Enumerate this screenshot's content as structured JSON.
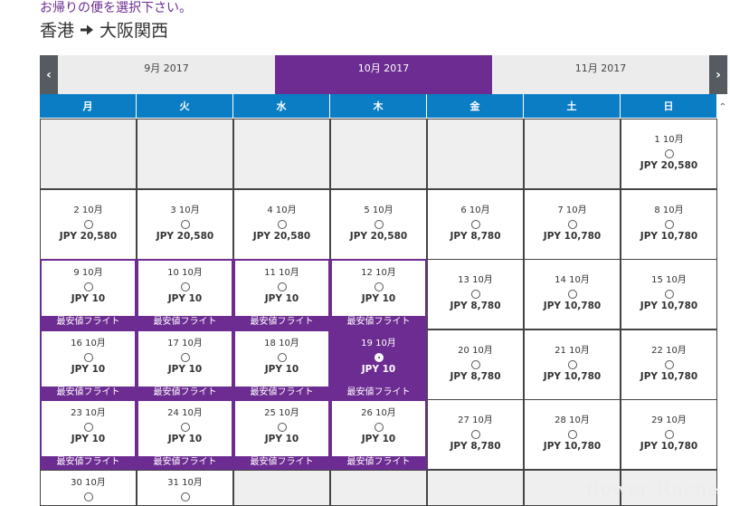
{
  "page": {
    "instruction": "お帰りの便を選択下さい。",
    "route_from": "香港",
    "route_to": "大阪関西"
  },
  "months": {
    "prev_icon": "chevron-left-icon",
    "next_icon": "chevron-right-icon",
    "tabs": [
      {
        "label": "9月 2017",
        "active": false
      },
      {
        "label": "10月 2017",
        "active": true
      },
      {
        "label": "11月 2017",
        "active": false
      }
    ]
  },
  "weekdays": [
    "月",
    "火",
    "水",
    "木",
    "金",
    "土",
    "日"
  ],
  "calendar": {
    "promo_label": "最安値フライト",
    "rows": [
      [
        null,
        null,
        null,
        null,
        null,
        null,
        {
          "date": "1 10月",
          "price": "JPY 20,580"
        }
      ],
      [
        {
          "date": "2 10月",
          "price": "JPY 20,580"
        },
        {
          "date": "3 10月",
          "price": "JPY 20,580"
        },
        {
          "date": "4 10月",
          "price": "JPY 20,580"
        },
        {
          "date": "5 10月",
          "price": "JPY 20,580"
        },
        {
          "date": "6 10月",
          "price": "JPY 8,780"
        },
        {
          "date": "7 10月",
          "price": "JPY 10,780"
        },
        {
          "date": "8 10月",
          "price": "JPY 10,780"
        }
      ],
      [
        {
          "date": "9 10月",
          "price": "JPY 10",
          "promo": true
        },
        {
          "date": "10 10月",
          "price": "JPY 10",
          "promo": true
        },
        {
          "date": "11 10月",
          "price": "JPY 10",
          "promo": true
        },
        {
          "date": "12 10月",
          "price": "JPY 10",
          "promo": true
        },
        {
          "date": "13 10月",
          "price": "JPY 8,780"
        },
        {
          "date": "14 10月",
          "price": "JPY 10,780"
        },
        {
          "date": "15 10月",
          "price": "JPY 10,780"
        }
      ],
      [
        {
          "date": "16 10月",
          "price": "JPY 10",
          "promo": true
        },
        {
          "date": "17 10月",
          "price": "JPY 10",
          "promo": true
        },
        {
          "date": "18 10月",
          "price": "JPY 10",
          "promo": true
        },
        {
          "date": "19 10月",
          "price": "JPY 10",
          "promo": true,
          "selected": true
        },
        {
          "date": "20 10月",
          "price": "JPY 8,780"
        },
        {
          "date": "21 10月",
          "price": "JPY 10,780"
        },
        {
          "date": "22 10月",
          "price": "JPY 10,780"
        }
      ],
      [
        {
          "date": "23 10月",
          "price": "JPY 10",
          "promo": true
        },
        {
          "date": "24 10月",
          "price": "JPY 10",
          "promo": true
        },
        {
          "date": "25 10月",
          "price": "JPY 10",
          "promo": true
        },
        {
          "date": "26 10月",
          "price": "JPY 10",
          "promo": true
        },
        {
          "date": "27 10月",
          "price": "JPY 8,780"
        },
        {
          "date": "28 10月",
          "price": "JPY 10,780"
        },
        {
          "date": "29 10月",
          "price": "JPY 10,780"
        }
      ],
      [
        {
          "date": "30 10月",
          "price": "",
          "partial": true
        },
        {
          "date": "31 10月",
          "price": "",
          "partial": true
        },
        null,
        null,
        null,
        null,
        null
      ]
    ]
  },
  "watermark": "flower-Ruche"
}
